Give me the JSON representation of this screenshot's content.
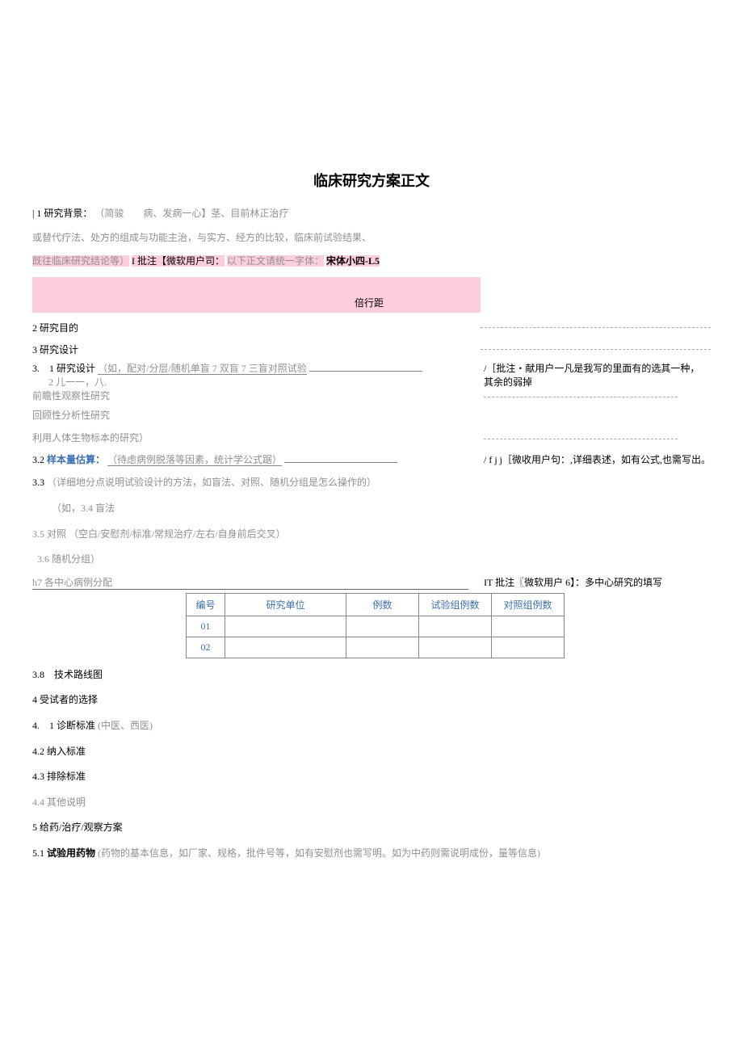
{
  "title": "临床研究方案正文",
  "s1": {
    "prefix": "| 1 研究背景：",
    "gray1": "（简骏　　病、发病一心】茎、目前林正治疗",
    "gray2": "或替代疗法、处方的组成与功能主治，与实方、经方的比较，临床前试验结果、",
    "gray3": "既往临床研究结论等）",
    "note1a": "I 批注【微软用户司：",
    "note1b": "以下正文请统一字体：",
    "note1c": "宋体小四-L5",
    "pinkword": "倍行距"
  },
  "s2": {
    "label": "2 研究目的"
  },
  "s3": {
    "label": "3 研究设计",
    "s31": {
      "num": "3.　1",
      "label": "研究设计",
      "gray": "（如，配对/分层/随机单盲 7 双盲 7 三盲对照试验"
    },
    "comment2a": "/［批注・献用户一凡是我写的里面有的选其一种，",
    "comment2b": "其余的弱掉",
    "sub1": "2 儿一一，八.",
    "sub2": "前瞻性观察性研究",
    "sub3": "回顾性分析性研究",
    "sub4": "利用人体生物标本的研究）",
    "s32": {
      "num": "3.2",
      "bold": "样本量估算：",
      "gray": "（待虑病例脱落等因素，统计学公式踞）"
    },
    "comment3": "/ f j j［微收用户句：,详细表述，如有公式,也需写出。",
    "s33": {
      "num": "3.3",
      "gray": "（详细地分点说明试验设计的方法，如盲法、对照、随机分组是怎么操作的）"
    },
    "s34": "（如，3.4 盲法",
    "s35": {
      "num": "3.5",
      "label": "对照",
      "gray": "（空白/安慰剂/标准/常规治疗/左右/自身前后交叉）"
    },
    "s36": "3.6 随机分组）",
    "s37": {
      "label": "h7 各中心病例分配",
      "comment": "IT 批注〖微软用户 6】：多中心研究的填写"
    },
    "table": {
      "headers": [
        "编号",
        "研究单位",
        "例数",
        "试验组例数",
        "对照组例数"
      ],
      "rows": [
        [
          "01",
          "",
          "",
          "",
          ""
        ],
        [
          "02",
          "",
          "",
          "",
          ""
        ]
      ]
    },
    "s38": "3.8　技术路线图"
  },
  "s4": {
    "label": "4 受试者的选择",
    "s41": {
      "num": "4.　1",
      "label": "诊断标准",
      "gray": "(中医、西医)"
    },
    "s42": "4.2 纳入标准",
    "s43": "4.3 排除标准",
    "s44": "4.4 其他说明"
  },
  "s5": {
    "label": "5 给药/治疗/观察方案",
    "s51": {
      "num": "5.1",
      "bold": "试验用药物",
      "gray": "(药物的基本信息，如厂家、规格，批件号等，如有安慰剂也需写明。如为中药则需说明成份，量等信息)"
    }
  }
}
